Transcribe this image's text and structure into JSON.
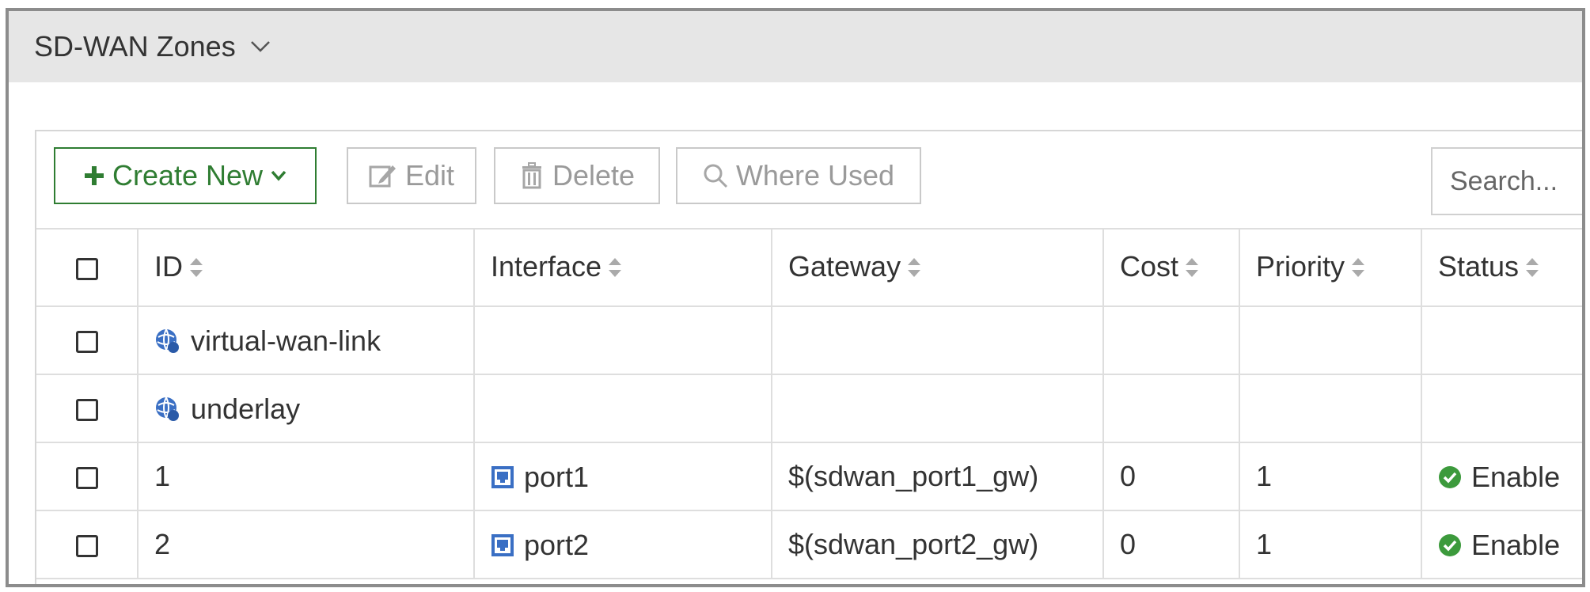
{
  "header": {
    "title": "SD-WAN Zones"
  },
  "toolbar": {
    "create_label": "Create New",
    "edit_label": "Edit",
    "delete_label": "Delete",
    "where_used_label": "Where Used",
    "search_placeholder": "Search..."
  },
  "table": {
    "columns": [
      "ID",
      "Interface",
      "Gateway",
      "Cost",
      "Priority",
      "Status"
    ],
    "rows": [
      {
        "id": "virtual-wan-link",
        "id_icon": "zone-icon",
        "interface": "",
        "gateway": "",
        "cost": "",
        "priority": "",
        "status": ""
      },
      {
        "id": "underlay",
        "id_icon": "zone-icon",
        "interface": "",
        "gateway": "",
        "cost": "",
        "priority": "",
        "status": ""
      },
      {
        "id": "1",
        "interface": "port1",
        "interface_icon": "port-icon",
        "gateway": "$(sdwan_port1_gw)",
        "cost": "0",
        "priority": "1",
        "status": "Enable",
        "status_icon": "check-circle-icon"
      },
      {
        "id": "2",
        "interface": "port2",
        "interface_icon": "port-icon",
        "gateway": "$(sdwan_port2_gw)",
        "cost": "0",
        "priority": "1",
        "status": "Enable",
        "status_icon": "check-circle-icon"
      }
    ]
  },
  "colors": {
    "accent_green": "#2f7d32",
    "status_green": "#3c9a3c",
    "icon_blue": "#3a6fc4"
  }
}
